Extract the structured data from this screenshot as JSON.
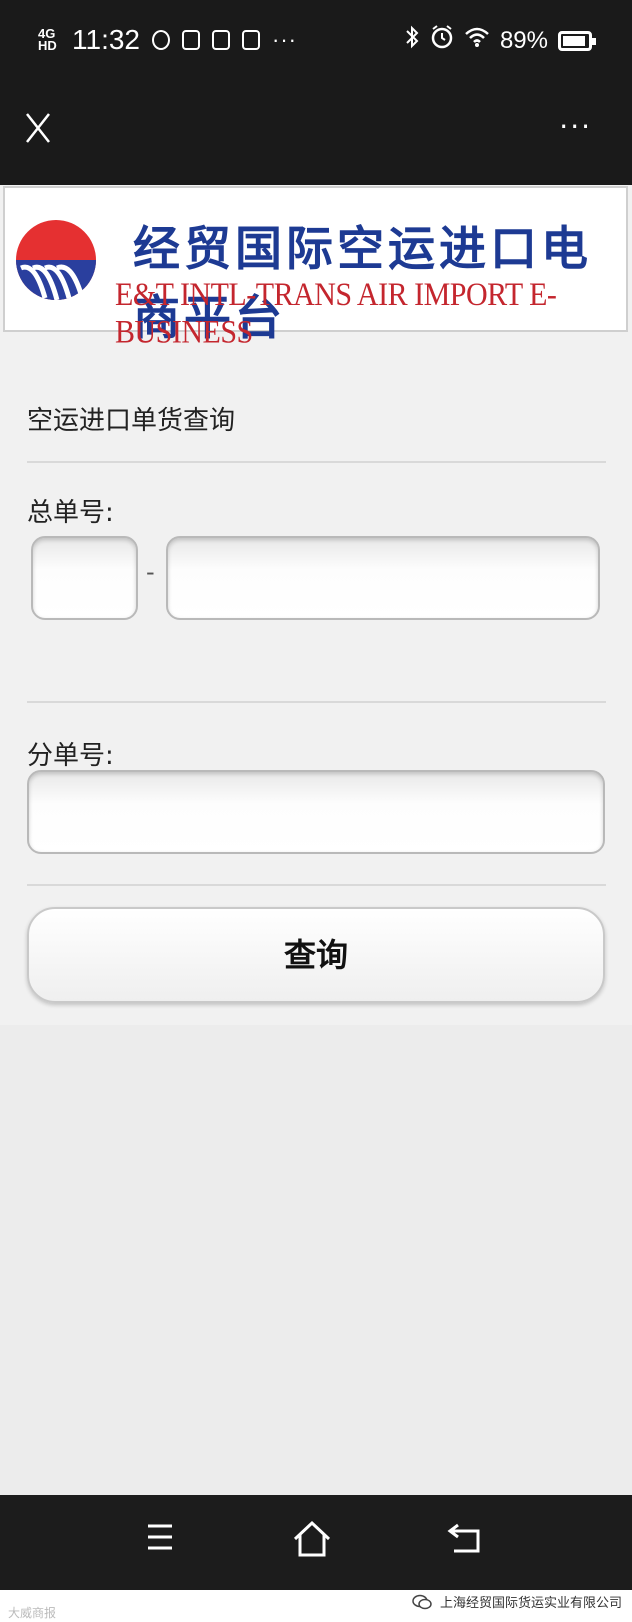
{
  "status_bar": {
    "signal": "4G HD",
    "time": "11:32",
    "more": "···",
    "battery": "89%"
  },
  "header": {
    "close_label": "X",
    "more_label": "···"
  },
  "banner": {
    "title_cn": "经贸国际空运进口电商平台",
    "title_en": "E&T INTL-TRANS AIR IMPORT E-BUSINESS"
  },
  "form": {
    "page_title": "空运进口单货查询",
    "master_label": "总单号:",
    "master_prefix_value": "",
    "master_number_value": "",
    "dash": "-",
    "house_label": "分单号:",
    "house_value": "",
    "query_button": "查询"
  },
  "footer": {
    "watermark_left": "大威商报",
    "watermark_right": "上海经贸国际货运实业有限公司"
  },
  "colors": {
    "brand_blue": "#1d3a93",
    "brand_red": "#c4262e",
    "bar_black": "#1a1a1a"
  }
}
